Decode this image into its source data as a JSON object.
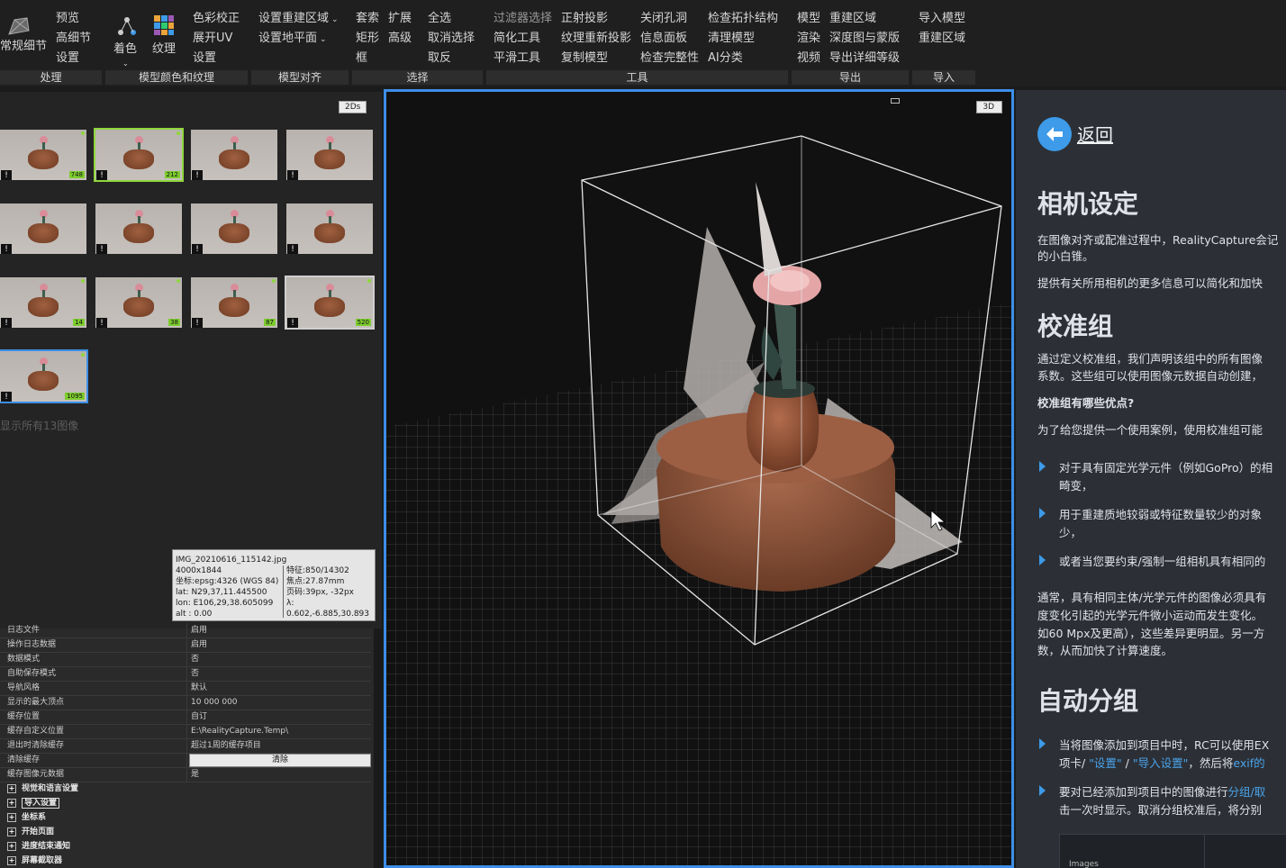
{
  "ribbon": {
    "col1": [
      "常规细节"
    ],
    "col2": [
      "预览",
      "高细节",
      "设置"
    ],
    "colorize": "着色",
    "texture": "纹理",
    "col4": [
      "色彩校正",
      "展开UV",
      "设置"
    ],
    "col5": [
      "设置重建区域",
      "设置地平面"
    ],
    "col6a": [
      "套索",
      "矩形",
      "框"
    ],
    "col6b": [
      "扩展",
      "高级"
    ],
    "col7": [
      "全选",
      "取消选择",
      "取反"
    ],
    "col8": [
      "过滤器选择",
      "简化工具",
      "平滑工具"
    ],
    "col9": [
      "正射投影",
      "纹理重新投影",
      "复制模型"
    ],
    "col10": [
      "关闭孔洞",
      "信息面板",
      "检查完整性"
    ],
    "col11": [
      "检查拓扑结构",
      "清理模型",
      "AI分类"
    ],
    "col12": [
      "模型",
      "渲染",
      "视频"
    ],
    "col13": [
      "重建区域",
      "深度图与蒙版",
      "导出详细等级"
    ],
    "col14": [
      "导入模型",
      "重建区域"
    ],
    "groups": [
      "处理",
      "模型颜色和纹理",
      "模型对齐",
      "选择",
      "工具",
      "导出",
      "导入"
    ]
  },
  "left": {
    "badge": "2Ds",
    "thumbs": [
      {
        "count": "748"
      },
      {
        "count": "212"
      },
      {
        "count": ""
      },
      {
        "count": ""
      },
      {
        "count": ""
      },
      {
        "count": ""
      },
      {
        "count": ""
      },
      {
        "count": ""
      },
      {
        "count": "14"
      },
      {
        "count": "38"
      },
      {
        "count": "87"
      },
      {
        "count": "520"
      },
      {
        "count": "1095"
      }
    ],
    "show_all": "显示所有13图像",
    "info": {
      "filename": "IMG_20210616_115142.jpg",
      "size": "4000x1844",
      "coord": "坐标:epsg:4326 (WGS 84)",
      "lat": "lat: N29,37,11.445500",
      "lon": "lon: E106,29,38.605099",
      "alt": "alt : 0.00",
      "features": "特征:850/14302",
      "focal": "焦点:27.87mm",
      "pp": "页码:39px, -32px",
      "lambda": "λ: 0.602,-6.885,30.893"
    },
    "props": [
      {
        "k": "日志文件",
        "v": "启用"
      },
      {
        "k": "操作日志数据",
        "v": "启用"
      },
      {
        "k": "数据模式",
        "v": "否"
      },
      {
        "k": "自助保存模式",
        "v": "否"
      },
      {
        "k": "导航风格",
        "v": "默认"
      },
      {
        "k": "显示的最大顶点",
        "v": "10 000 000"
      },
      {
        "k": "缓存位置",
        "v": "自订"
      },
      {
        "k": "缓存自定义位置",
        "v": "E:\\RealityCapture.Temp\\"
      },
      {
        "k": "退出时清除缓存",
        "v": "超过1周的缓存项目"
      },
      {
        "k": "清除缓存",
        "v": "清除"
      },
      {
        "k": "缓存图像元数据",
        "v": "是"
      }
    ],
    "sections": [
      "视觉和语言设置",
      "导入设置",
      "坐标系",
      "开始页面",
      "进度结束通知",
      "屏幕截取器"
    ]
  },
  "viewport": {
    "badge": "3D"
  },
  "help": {
    "back": "返回",
    "h1": "相机设定",
    "p1": "在图像对齐或配准过程中，RealityCapture会记",
    "p1b": "的小白锥。",
    "p2": "提供有关所用相机的更多信息可以简化和加快",
    "h2": "校准组",
    "p3": "通过定义校准组，我们声明该组中的所有图像",
    "p3b": "系数。这些组可以使用图像元数据自动创建，",
    "q": "校准组有哪些优点?",
    "p4": "为了给您提供一个使用案例，使用校准组可能",
    "b1": "对于具有固定光学元件（例如GoPro）的相",
    "b1b": "畸变，",
    "b2": "用于重建质地较弱或特征数量较少的对象",
    "b2b": "少，",
    "b3": "或者当您要约束/强制一组相机具有相同的",
    "p5": "通常，具有相同主体/光学元件的图像必须具有",
    "p5b": "度变化引起的光学元件微小运动而发生变化。",
    "p5c": "如60 Mpx及更高），这些差异更明显。另一方",
    "p5d": "数，从而加快了计算速度。",
    "h3": "自动分组",
    "b4": "当将图像添加到项目中时，RC可以使用EX",
    "b4b_pre": "项卡/ ",
    "b4b_l1": "\"设置\"",
    "b4b_mid": " / ",
    "b4b_l2": "\"导入设置\"",
    "b4b_post": "，然后将",
    "b4b_l3": "exif的",
    "b5_pre": "要对已经添加到项目中的图像进行",
    "b5_link": "分组/取",
    "b5b": "击一次时显示。取消分组校准后，将分别",
    "embed_label": "Images"
  },
  "colors": {
    "accent": "#3d8ee8",
    "selected_green": "#8fd63d",
    "help_bg": "#2c3036",
    "link": "#4aa3ea"
  }
}
